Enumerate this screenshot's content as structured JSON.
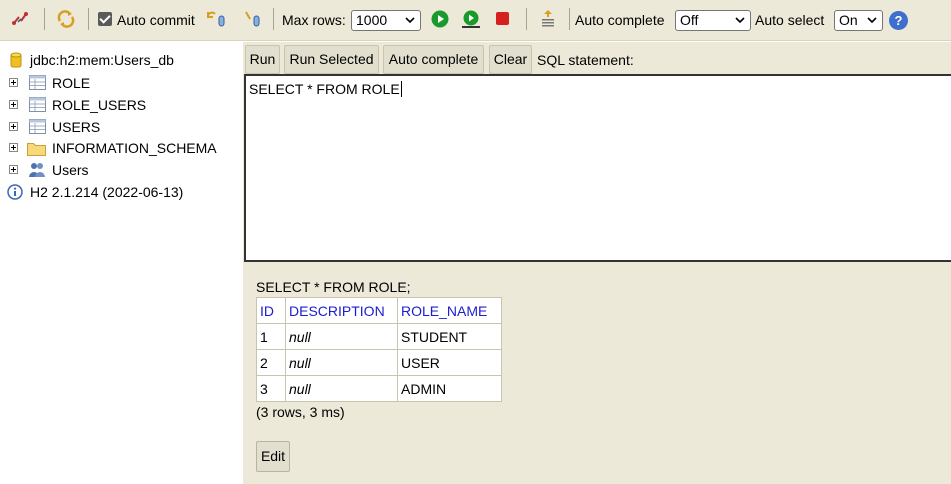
{
  "toolbar": {
    "auto_commit_label": "Auto commit",
    "auto_commit_checked": true,
    "max_rows_label": "Max rows:",
    "max_rows_value": "1000",
    "auto_complete_label": "Auto complete",
    "auto_complete_value": "Off",
    "auto_select_label": "Auto select",
    "auto_select_value": "On",
    "help_glyph": "?",
    "icons": [
      "disconnect-icon",
      "refresh-icon",
      "rollback-icon",
      "commit-icon",
      "run-icon",
      "run-selected-icon",
      "stop-icon",
      "history-icon",
      "help-icon"
    ]
  },
  "tree": {
    "connection": "jdbc:h2:mem:Users_db",
    "tables": [
      "ROLE",
      "ROLE_USERS",
      "USERS"
    ],
    "schema": "INFORMATION_SCHEMA",
    "users": "Users",
    "version": "H2 2.1.214 (2022-06-13)"
  },
  "buttons": {
    "run": "Run",
    "run_selected": "Run Selected",
    "auto_complete": "Auto complete",
    "clear": "Clear",
    "sql_statement_label": "SQL statement:"
  },
  "editor": {
    "text": "SELECT * FROM ROLE"
  },
  "result": {
    "sql": "SELECT * FROM ROLE;",
    "columns": [
      "ID",
      "DESCRIPTION",
      "ROLE_NAME"
    ],
    "rows": [
      [
        "1",
        "null",
        "STUDENT"
      ],
      [
        "2",
        "null",
        "USER"
      ],
      [
        "3",
        "null",
        "ADMIN"
      ]
    ],
    "status": "(3 rows, 3 ms)",
    "edit_label": "Edit"
  },
  "colors": {
    "panel_bg": "#ece9d8",
    "header_link": "#1c1cd0",
    "run_green": "#1a9a2a",
    "stop_red": "#d62020"
  }
}
